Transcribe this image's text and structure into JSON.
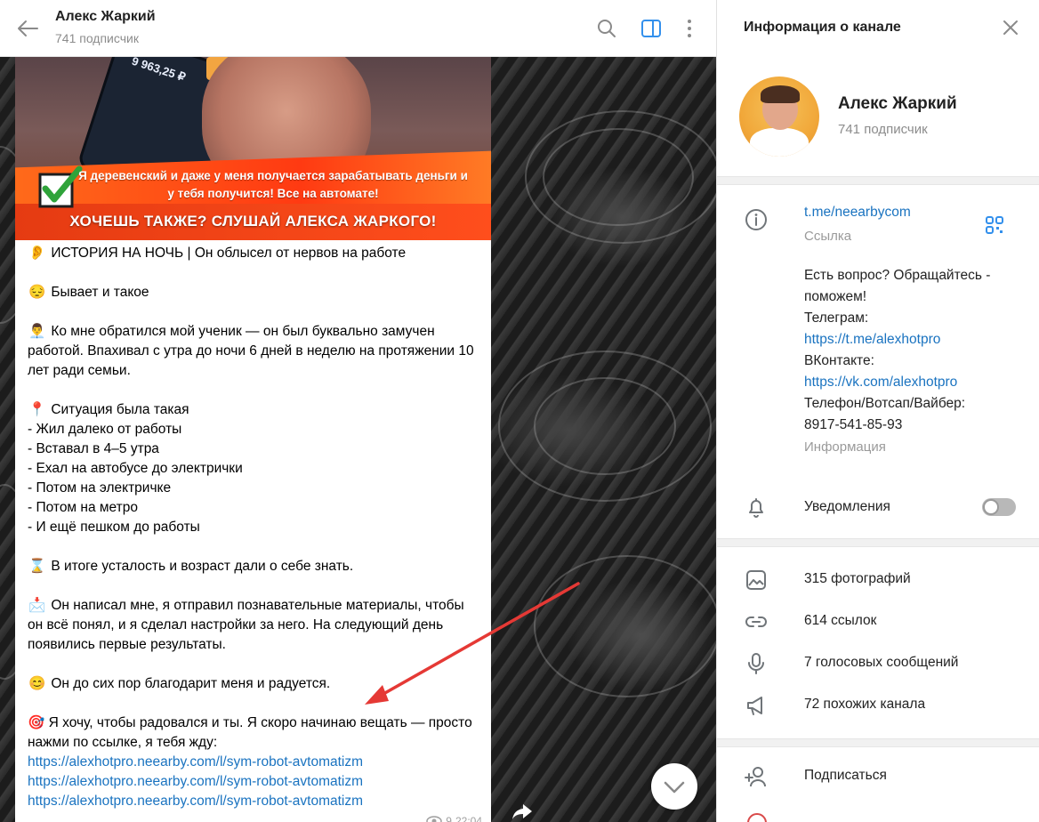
{
  "chat": {
    "title": "Алекс Жаркий",
    "subtitle": "741 подписчик",
    "banner": {
      "phone_amount": "9 963,25 ₽",
      "strip_line": "Я деревенский и даже у меня получается зарабатывать деньги и у тебя получится! Все на автомате!",
      "strip_headline": "ХОЧЕШЬ ТАКЖЕ? СЛУШАЙ АЛЕКСА ЖАРКОГО!"
    },
    "message": {
      "p1_emoji": "👂",
      "p1": "ИСТОРИЯ НА НОЧЬ | Он облысел от нервов на работе",
      "p2_emoji": "😔",
      "p2": "Бывает и такое",
      "p3_emoji": "👨‍💼",
      "p3": "Ко мне обратился мой ученик — он был буквально замучен работой. Впахивал с утра до ночи 6 дней в неделю на протяжении 10 лет ради семьи.",
      "p4_emoji": "📍",
      "p4": "Ситуация была такая\n- Жил далеко от работы\n- Вставал в 4–5 утра\n- Ехал на автобусе до электрички\n- Потом на электричке\n- Потом на метро\n- И ещё пешком до работы",
      "p5_emoji": "⌛",
      "p5": "В итоге усталость и возраст дали о себе знать.",
      "p6_emoji": "📩",
      "p6": "Он написал мне, я отправил познавательные материалы, чтобы он всё понял, и я сделал настройки за него. На следующий день появились первые результаты.",
      "p7_emoji": "😊",
      "p7": "Он до сих пор благодарит меня и радуется.",
      "p8_emoji": "🎯",
      "p8": "Я хочу, чтобы радовался и ты. Я скоро начинаю вещать — просто нажми по ссылке, я тебя жду:",
      "links": [
        "https://alexhotpro.neearby.com/l/sym-robot-avtomatizm",
        "https://alexhotpro.neearby.com/l/sym-robot-avtomatizm",
        "https://alexhotpro.neearby.com/l/sym-robot-avtomatizm"
      ],
      "views": "9",
      "time": "22:04"
    }
  },
  "panel": {
    "title": "Информация о канале",
    "name": "Алекс Жаркий",
    "subscribers": "741 подписчик",
    "link": "t.me/neearbycom",
    "link_caption": "Ссылка",
    "description": {
      "line1": "Есть вопрос? Обращайтесь - поможем!",
      "line2": "Телеграм:",
      "tg_link": "https://t.me/alexhotpro",
      "line3": "ВКонтакте:",
      "vk_link": "https://vk.com/alexhotpro",
      "line4": "Телефон/Вотсап/Вайбер:",
      "phone": "8917-541-85-93"
    },
    "description_caption": "Информация",
    "notifications_label": "Уведомления",
    "notifications_on": false,
    "media": {
      "photos": "315 фотографий",
      "links": "614 ссылок",
      "voice": "7 голосовых сообщений",
      "similar": "72 похожих канала"
    },
    "subscribe_label": "Подписаться"
  },
  "colors": {
    "accent": "#1a73c0",
    "sidebar_toggle": "#3390ec",
    "arrow": "#e53935"
  }
}
